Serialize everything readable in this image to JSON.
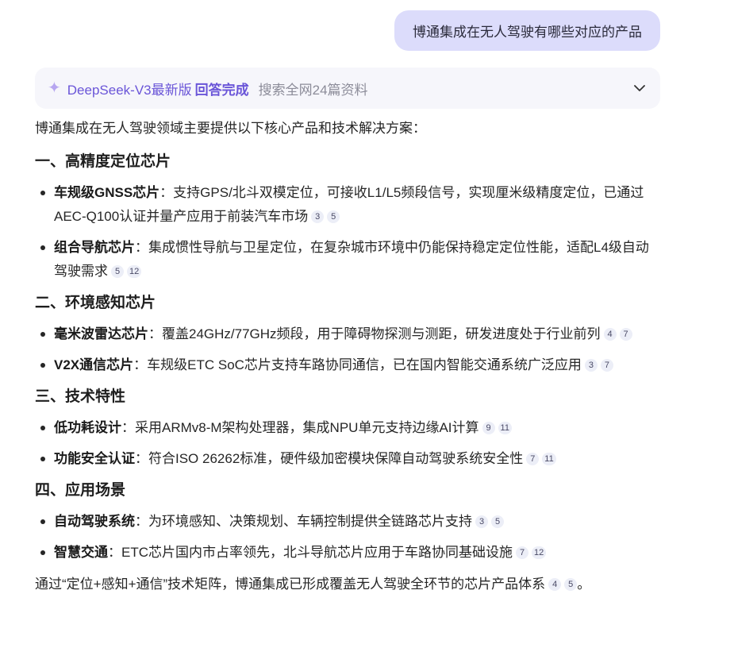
{
  "user_message": "博通集成在无人驾驶有哪些对应的产品",
  "status": {
    "model": "DeepSeek-V3最新版",
    "state": "回答完成",
    "sources": "搜索全网24篇资料"
  },
  "answer": {
    "intro": "博通集成在无人驾驶领域主要提供以下核心产品和技术解决方案：",
    "sections": [
      {
        "title": "一、高精度定位芯片",
        "items": [
          {
            "bold": "车规级GNSS芯片",
            "text": "：支持GPS/北斗双模定位，可接收L1/L5频段信号，实现厘米级精度定位，已通过AEC-Q100认证并量产应用于前装汽车市场",
            "cites": [
              "3",
              "5"
            ]
          },
          {
            "bold": "组合导航芯片",
            "text": "：集成惯性导航与卫星定位，在复杂城市环境中仍能保持稳定定位性能，适配L4级自动驾驶需求",
            "cites": [
              "5",
              "12"
            ]
          }
        ]
      },
      {
        "title": "二、环境感知芯片",
        "items": [
          {
            "bold": "毫米波雷达芯片",
            "text": "：覆盖24GHz/77GHz频段，用于障碍物探测与测距，研发进度处于行业前列",
            "cites": [
              "4",
              "7"
            ]
          },
          {
            "bold": "V2X通信芯片",
            "text": "：车规级ETC SoC芯片支持车路协同通信，已在国内智能交通系统广泛应用",
            "cites": [
              "3",
              "7"
            ]
          }
        ]
      },
      {
        "title": "三、技术特性",
        "items": [
          {
            "bold": "低功耗设计",
            "text": "：采用ARMv8-M架构处理器，集成NPU单元支持边缘AI计算",
            "cites": [
              "9",
              "11"
            ]
          },
          {
            "bold": "功能安全认证",
            "text": "：符合ISO 26262标准，硬件级加密模块保障自动驾驶系统安全性",
            "cites": [
              "7",
              "11"
            ]
          }
        ]
      },
      {
        "title": "四、应用场景",
        "items": [
          {
            "bold": "自动驾驶系统",
            "text": "：为环境感知、决策规划、车辆控制提供全链路芯片支持",
            "cites": [
              "3",
              "5"
            ]
          },
          {
            "bold": "智慧交通",
            "text": "：ETC芯片国内市占率领先，北斗导航芯片应用于车路协同基础设施",
            "cites": [
              "7",
              "12"
            ]
          }
        ]
      }
    ],
    "conclusion": "通过“定位+感知+通信”技术矩阵，博通集成已形成覆盖无人驾驶全环节的芯片产品体系",
    "conclusion_cites": [
      "4",
      "5"
    ],
    "conclusion_end": "。"
  },
  "icons": {
    "sparkle": "sparkle-icon",
    "chevron": "chevron-down-icon"
  },
  "colors": {
    "user_bubble": "#dcdcfb",
    "accent": "#6a55d8",
    "status_bg": "#f6f6fb",
    "citation_bg": "#eceef7"
  }
}
